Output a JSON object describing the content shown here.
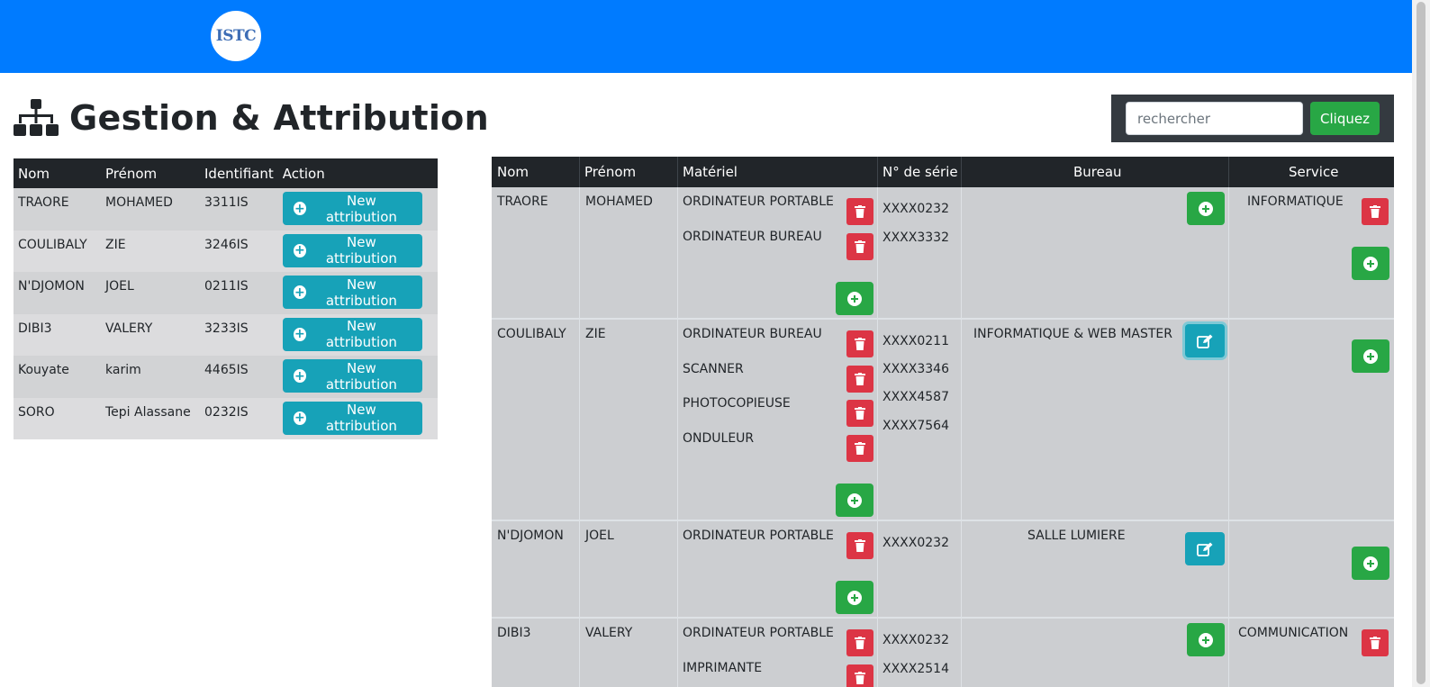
{
  "navbar": {
    "logo_text": "ISTC",
    "color": "#007bff"
  },
  "page": {
    "title": "Gestion & Attribution",
    "title_icon": "sitemap-icon"
  },
  "search": {
    "placeholder": "rechercher",
    "button_label": "Cliquez"
  },
  "left_table": {
    "headers": [
      "Nom",
      "Prénom",
      "Identifiant",
      "Action"
    ],
    "action_label": "New attribution",
    "rows": [
      {
        "nom": "TRAORE",
        "prenom": "MOHAMED",
        "id": "3311IS"
      },
      {
        "nom": "COULIBALY",
        "prenom": "ZIE",
        "id": "3246IS"
      },
      {
        "nom": "N'DJOMON",
        "prenom": "JOEL",
        "id": "0211IS"
      },
      {
        "nom": "DIBI3",
        "prenom": "VALERY",
        "id": "3233IS"
      },
      {
        "nom": "Kouyate",
        "prenom": "karim",
        "id": "4465IS"
      },
      {
        "nom": "SORO",
        "prenom": "Tepi Alassane",
        "id": "0232IS"
      }
    ]
  },
  "right_table": {
    "headers": [
      "Nom",
      "Prénom",
      "Matériel",
      "N° de série",
      "Bureau",
      "Service"
    ],
    "rows": [
      {
        "nom": "TRAORE",
        "prenom": "MOHAMED",
        "materiels": [
          "ORDINATEUR PORTABLE",
          "ORDINATEUR BUREAU"
        ],
        "series": [
          "XXXX0232",
          "XXXX3332"
        ],
        "bureau": "",
        "service": "INFORMATIQUE"
      },
      {
        "nom": "COULIBALY",
        "prenom": "ZIE",
        "materiels": [
          "ORDINATEUR BUREAU",
          "SCANNER",
          "PHOTOCOPIEUSE",
          "ONDULEUR"
        ],
        "series": [
          "XXXX0211",
          "XXXX3346",
          "XXXX4587",
          "XXXX7564"
        ],
        "bureau": "INFORMATIQUE & WEB MASTER",
        "service": ""
      },
      {
        "nom": "N'DJOMON",
        "prenom": "JOEL",
        "materiels": [
          "ORDINATEUR PORTABLE"
        ],
        "series": [
          "XXXX0232"
        ],
        "bureau": "SALLE LUMIERE",
        "service": ""
      },
      {
        "nom": "DIBI3",
        "prenom": "VALERY",
        "materiels": [
          "ORDINATEUR PORTABLE",
          "IMPRIMANTE"
        ],
        "series": [
          "XXXX0232",
          "XXXX2514"
        ],
        "bureau": "",
        "service": "COMMUNICATION"
      }
    ]
  },
  "colors": {
    "primary": "#007bff",
    "info": "#17a2b8",
    "success": "#28a745",
    "danger": "#dc3545",
    "dark": "#343a40"
  }
}
